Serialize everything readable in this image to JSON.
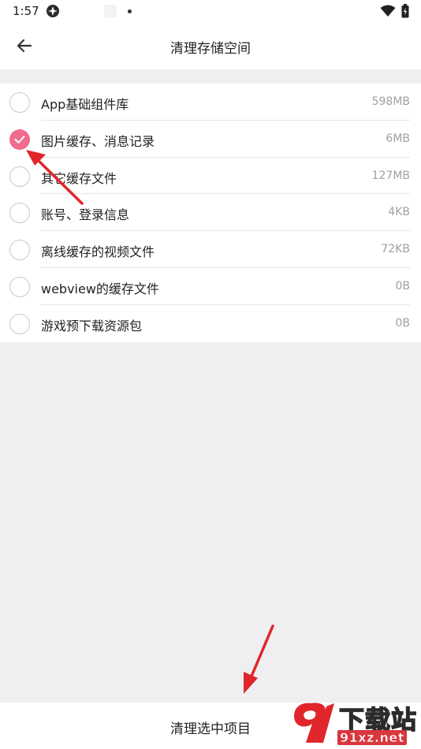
{
  "status_bar": {
    "time": "1:57"
  },
  "header": {
    "title": "清理存储空间",
    "back_icon": "arrow-left-icon"
  },
  "items": [
    {
      "label": "App基础组件库",
      "size": "598MB",
      "checked": false
    },
    {
      "label": "图片缓存、消息记录",
      "size": "6MB",
      "checked": true
    },
    {
      "label": "其它缓存文件",
      "size": "127MB",
      "checked": false
    },
    {
      "label": "账号、登录信息",
      "size": "4KB",
      "checked": false
    },
    {
      "label": "离线缓存的视频文件",
      "size": "72KB",
      "checked": false
    },
    {
      "label": "webview的缓存文件",
      "size": "0B",
      "checked": false
    },
    {
      "label": "游戏预下载资源包",
      "size": "0B",
      "checked": false
    }
  ],
  "bottom": {
    "clean_label": "清理选中项目"
  },
  "watermark": {
    "text": "下载站",
    "url": "91xz.net"
  },
  "colors": {
    "accent": "#f06b8d",
    "annotation_arrow": "#e0262b"
  }
}
